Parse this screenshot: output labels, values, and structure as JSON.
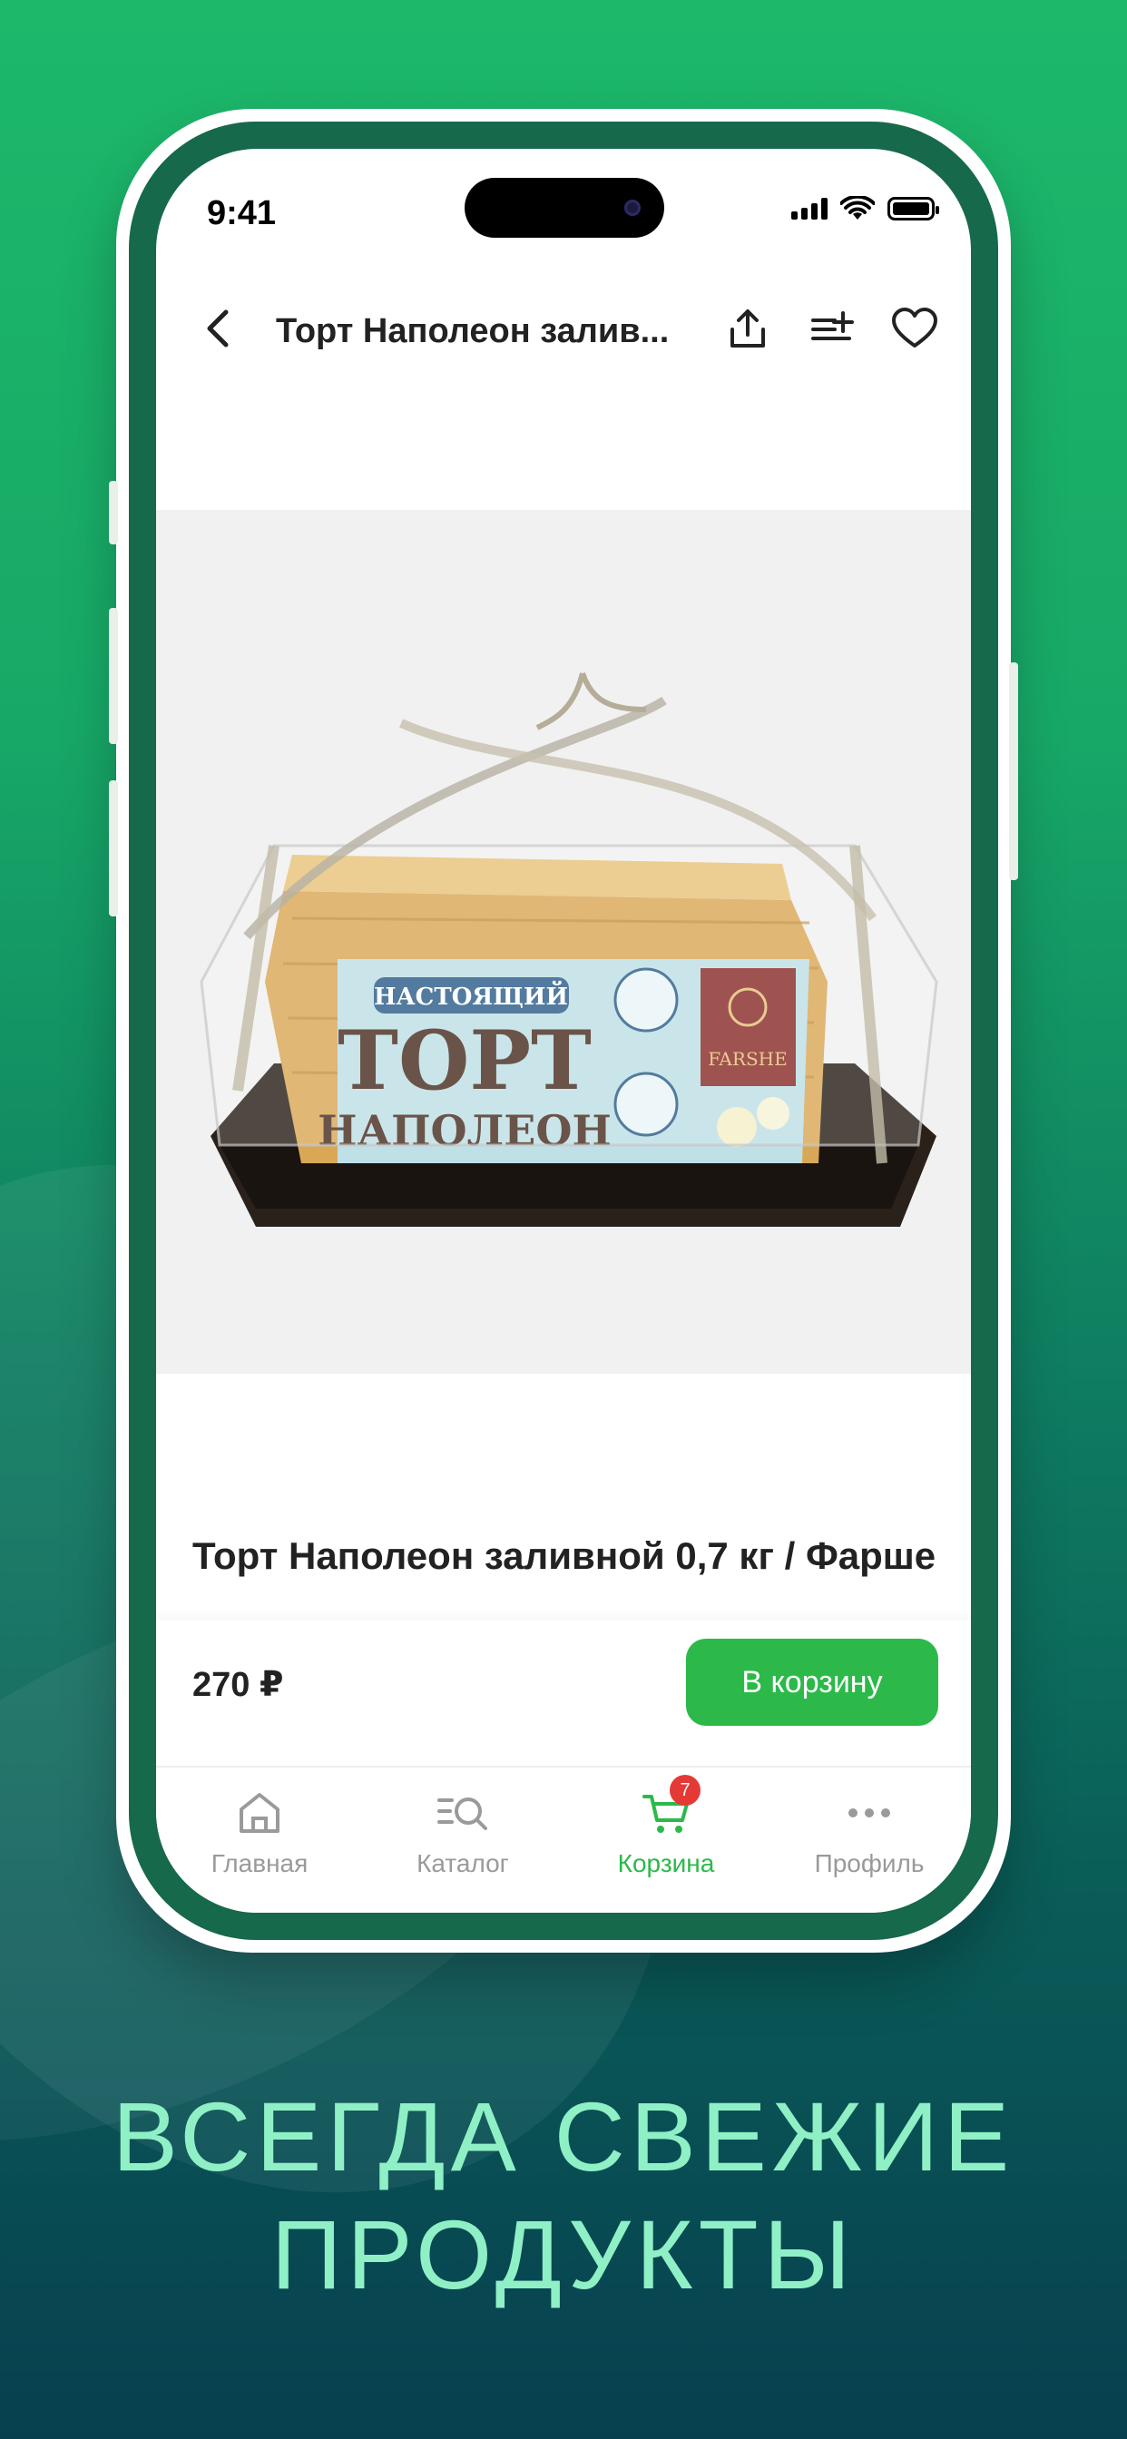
{
  "status_bar": {
    "time": "9:41"
  },
  "header": {
    "title": "Торт Наполеон залив...",
    "icons": [
      "back-icon",
      "share-icon",
      "add-to-list-icon",
      "heart-icon"
    ]
  },
  "product": {
    "package_text": [
      "НАСТОЯЩИЙ",
      "ТОРТ",
      "НАПОЛЕОН",
      "FARSHE"
    ],
    "title": "Торт Наполеон заливной 0,7 кг / Фарше",
    "price": "270 ₽",
    "cart_button": "В корзину"
  },
  "tabs": [
    {
      "label": "Главная",
      "icon": "home-icon",
      "active": false
    },
    {
      "label": "Каталог",
      "icon": "catalog-search-icon",
      "active": false
    },
    {
      "label": "Корзина",
      "icon": "cart-icon",
      "active": true,
      "badge": "7"
    },
    {
      "label": "Профиль",
      "icon": "more-dots-icon",
      "active": false
    }
  ],
  "headline": {
    "line1": "ВСЕГДА СВЕЖИЕ",
    "line2": "ПРОДУКТЫ"
  },
  "colors": {
    "accent": "#2cb94a",
    "frame": "#16694a",
    "headline": "#8ff0c6",
    "badge": "#e53935"
  }
}
